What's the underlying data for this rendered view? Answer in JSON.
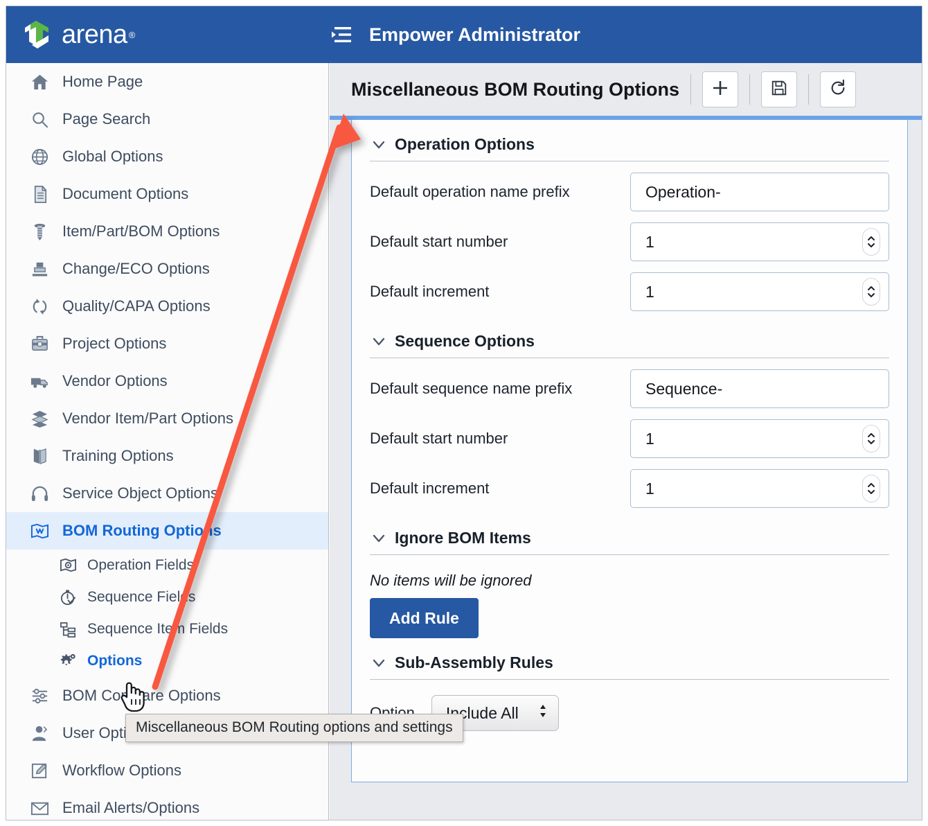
{
  "topbar": {
    "brand_name": "arena",
    "brand_reg": "®",
    "title": "Empower Administrator",
    "collapse_icon": "collapse-menu-icon",
    "bg_color": "#2758a3"
  },
  "sidebar": {
    "items": [
      {
        "label": "Home Page",
        "icon": "home-icon"
      },
      {
        "label": "Page Search",
        "icon": "search-icon"
      },
      {
        "label": "Global Options",
        "icon": "globe-icon"
      },
      {
        "label": "Document Options",
        "icon": "document-icon"
      },
      {
        "label": "Item/Part/BOM Options",
        "icon": "screw-icon"
      },
      {
        "label": "Change/ECO Options",
        "icon": "stamp-icon"
      },
      {
        "label": "Quality/CAPA Options",
        "icon": "refresh-cycle-icon"
      },
      {
        "label": "Project Options",
        "icon": "briefcase-icon"
      },
      {
        "label": "Vendor Options",
        "icon": "truck-icon"
      },
      {
        "label": "Vendor Item/Part Options",
        "icon": "boxes-icon"
      },
      {
        "label": "Training Options",
        "icon": "book-icon"
      },
      {
        "label": "Service Object Options",
        "icon": "headset-icon"
      },
      {
        "label": "BOM Routing Options",
        "icon": "routing-map-icon",
        "active": true
      },
      {
        "label": "BOM Compare Options",
        "icon": "sliders-icon"
      },
      {
        "label": "User Options",
        "icon": "user-icon"
      },
      {
        "label": "Workflow Options",
        "icon": "workflow-edit-icon"
      },
      {
        "label": "Email Alerts/Options",
        "icon": "envelope-icon"
      }
    ],
    "sub_items": [
      {
        "label": "Operation Fields",
        "icon": "operation-flag-icon"
      },
      {
        "label": "Sequence Fields",
        "icon": "stopwatch-check-icon"
      },
      {
        "label": "Sequence Item Fields",
        "icon": "hierarchy-icon"
      },
      {
        "label": "Options",
        "icon": "gears-icon",
        "active": true
      }
    ],
    "active_color": "#1267d8",
    "active_bg": "#e3eefc"
  },
  "main": {
    "title": "Miscellaneous BOM Routing Options",
    "toolbar_buttons": [
      {
        "name": "add-button",
        "icon": "plus-icon"
      },
      {
        "name": "save-button",
        "icon": "save-floppy-icon"
      },
      {
        "name": "refresh-button",
        "icon": "refresh-icon"
      }
    ],
    "sections": {
      "operation": {
        "title": "Operation Options",
        "fields": [
          {
            "label": "Default operation name prefix",
            "value": "Operation-",
            "type": "text"
          },
          {
            "label": "Default start number",
            "value": "1",
            "type": "number"
          },
          {
            "label": "Default increment",
            "value": "1",
            "type": "number"
          }
        ]
      },
      "sequence": {
        "title": "Sequence Options",
        "fields": [
          {
            "label": "Default sequence name prefix",
            "value": "Sequence-",
            "type": "text"
          },
          {
            "label": "Default start number",
            "value": "1",
            "type": "number"
          },
          {
            "label": "Default increment",
            "value": "1",
            "type": "number"
          }
        ]
      },
      "ignore": {
        "title": "Ignore BOM Items",
        "empty_text": "No items will be ignored",
        "add_rule_label": "Add Rule"
      },
      "subassembly": {
        "title": "Sub-Assembly Rules",
        "option_label": "Option",
        "option_value": "Include All"
      }
    },
    "accent_color": "#6ba3e8"
  },
  "annotations": {
    "tooltip_text": "Miscellaneous BOM Routing options and settings",
    "arrow_color": "#f9593f",
    "cursor_icon": "pointing-hand-cursor"
  }
}
